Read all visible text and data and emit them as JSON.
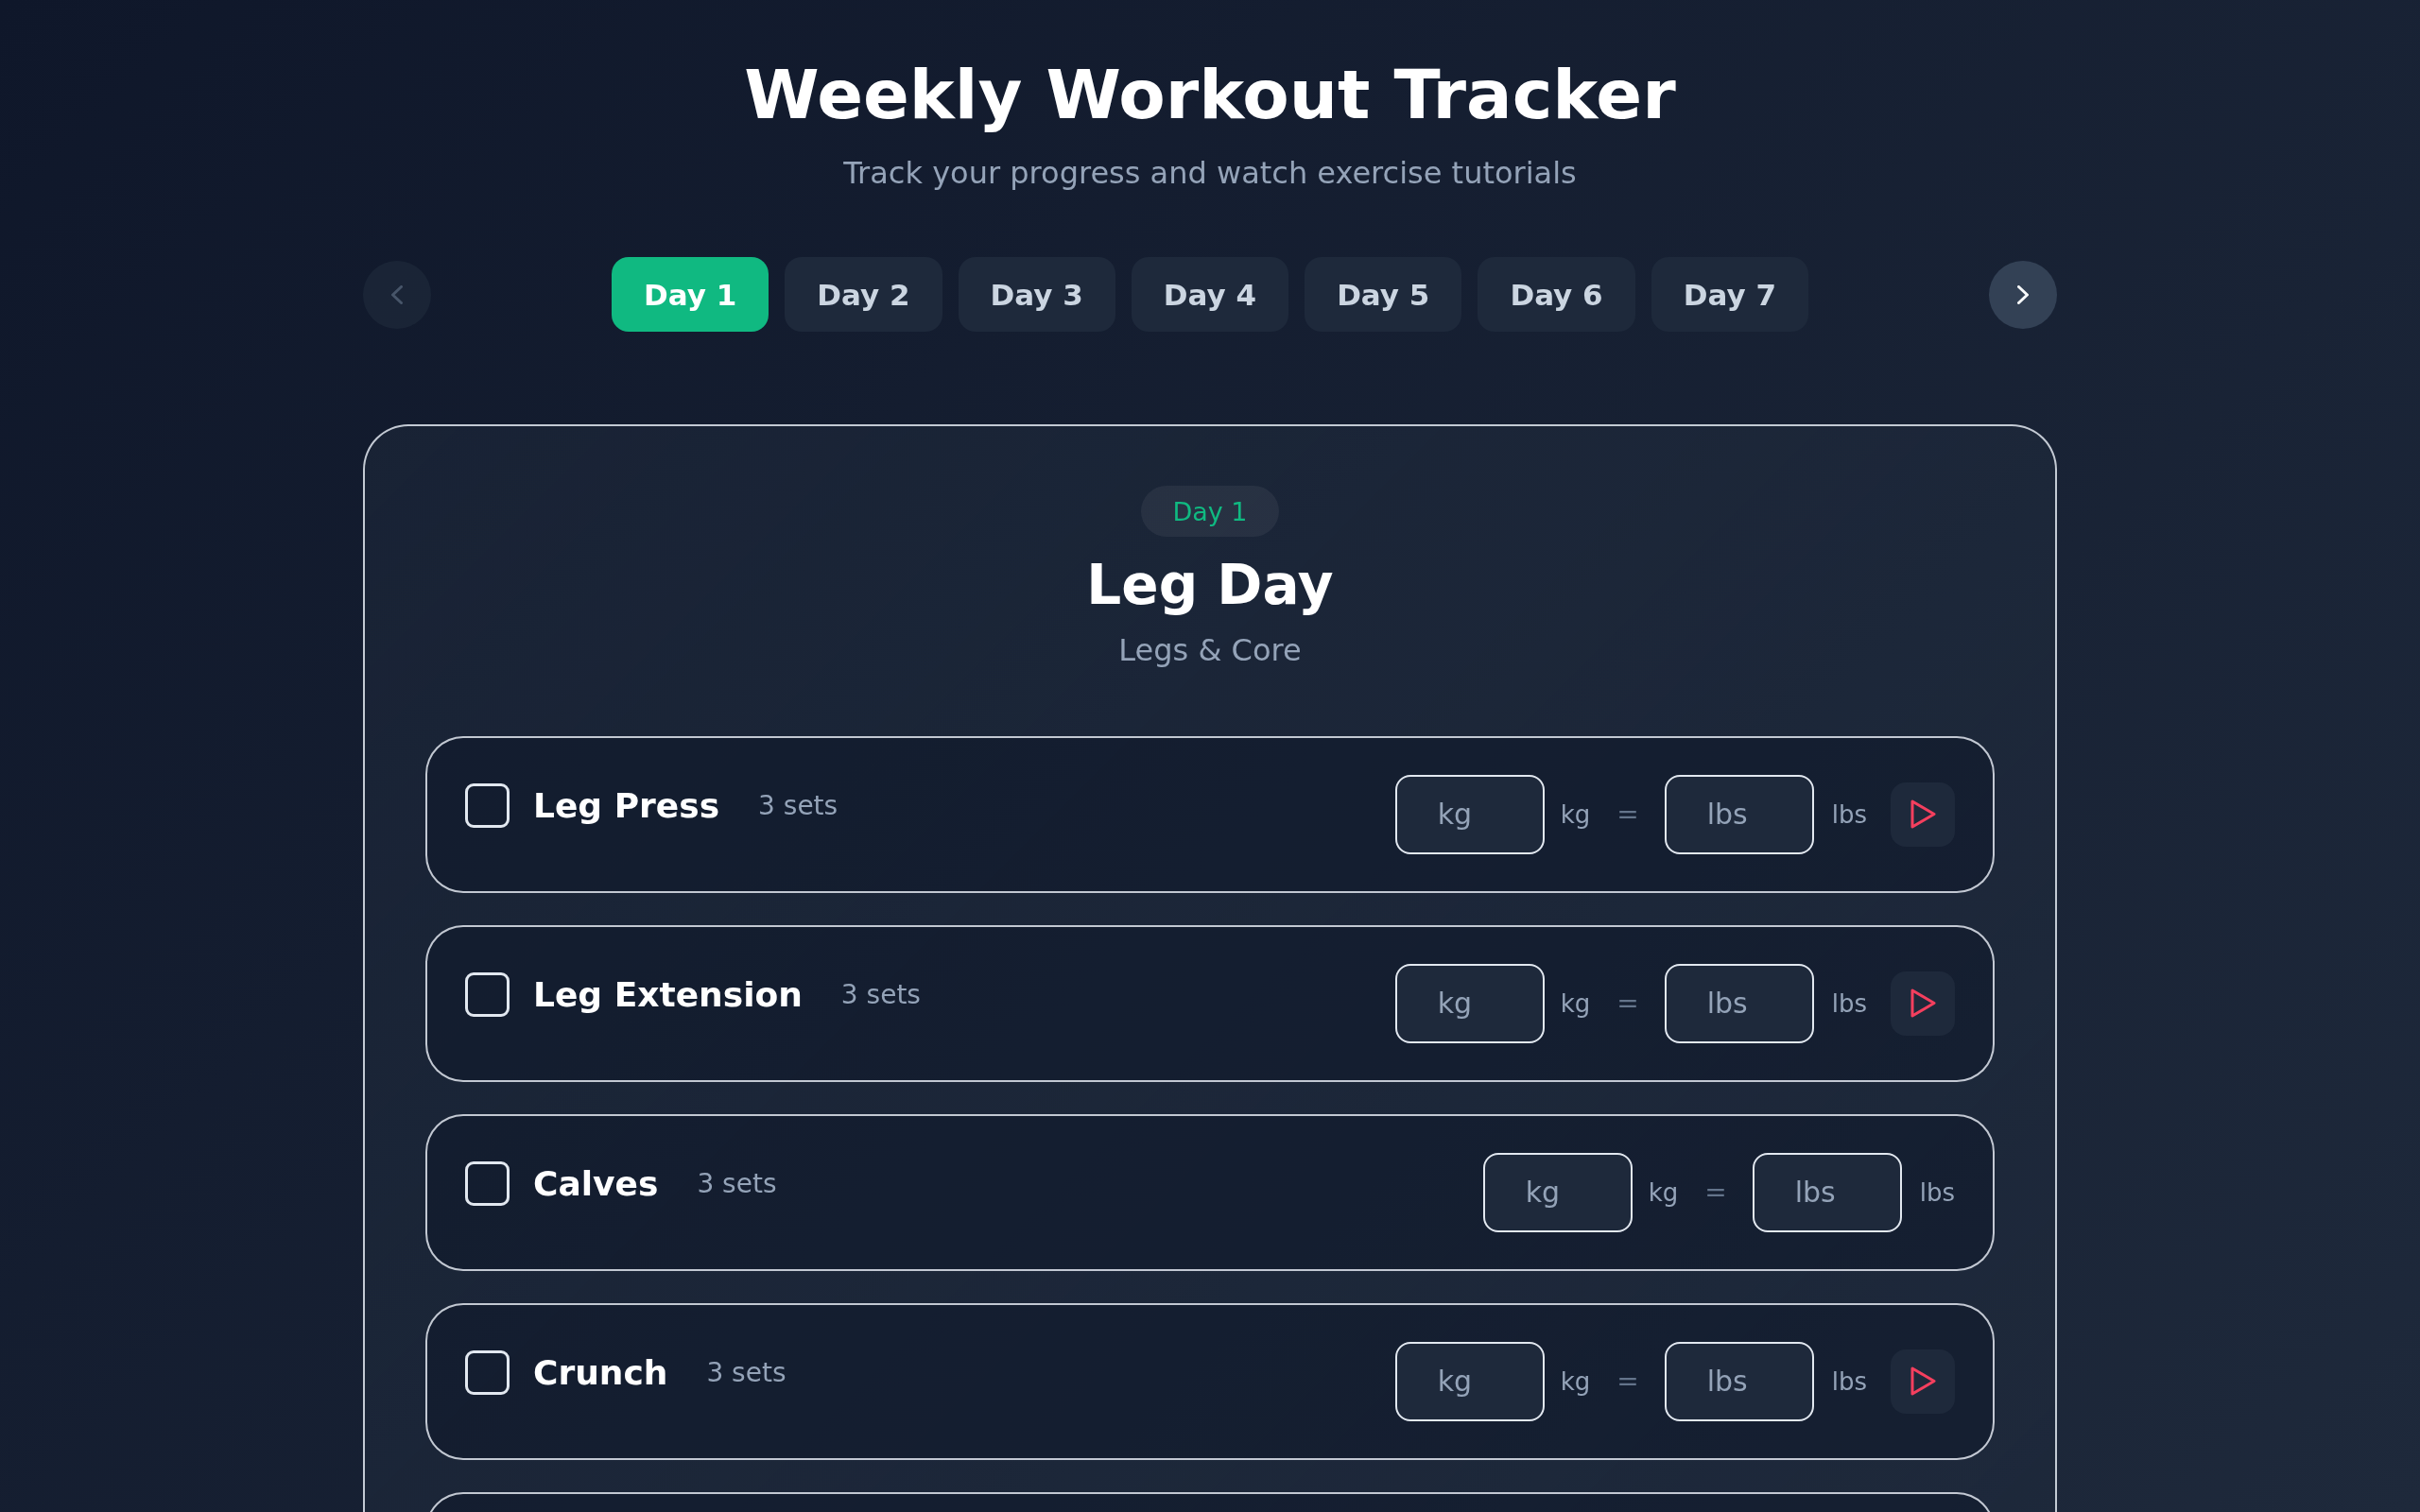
{
  "header": {
    "title": "Weekly Workout Tracker",
    "subtitle": "Track your progress and watch exercise tutorials"
  },
  "nav": {
    "prev": {
      "disabled": true
    },
    "next": {
      "disabled": false
    }
  },
  "tabs": [
    {
      "label": "Day 1",
      "selected": true
    },
    {
      "label": "Day 2",
      "selected": false
    },
    {
      "label": "Day 3",
      "selected": false
    },
    {
      "label": "Day 4",
      "selected": false
    },
    {
      "label": "Day 5",
      "selected": false
    },
    {
      "label": "Day 6",
      "selected": false
    },
    {
      "label": "Day 7",
      "selected": false
    }
  ],
  "day": {
    "badge": "Day 1",
    "title": "Leg Day",
    "focus": "Legs & Core"
  },
  "exercises": [
    {
      "name": "Leg Press",
      "sets": "3 sets",
      "checked": false,
      "kg_field": {
        "placeholder": "kg"
      },
      "kg_unit": "kg",
      "equals": "=",
      "lbs_field": {
        "placeholder": "lbs"
      },
      "lbs_unit": "lbs",
      "tutorial": true
    },
    {
      "name": "Leg Extension",
      "sets": "3 sets",
      "checked": false,
      "kg_field": {
        "placeholder": "kg"
      },
      "kg_unit": "kg",
      "equals": "=",
      "lbs_field": {
        "placeholder": "lbs"
      },
      "lbs_unit": "lbs",
      "tutorial": true
    },
    {
      "name": "Calves",
      "sets": "3 sets",
      "checked": false,
      "kg_field": {
        "placeholder": "kg"
      },
      "kg_unit": "kg",
      "equals": "=",
      "lbs_field": {
        "placeholder": "lbs"
      },
      "lbs_unit": "lbs",
      "tutorial": false
    },
    {
      "name": "Crunch",
      "sets": "3 sets",
      "checked": false,
      "kg_field": {
        "placeholder": "kg"
      },
      "kg_unit": "kg",
      "equals": "=",
      "lbs_field": {
        "placeholder": "lbs"
      },
      "lbs_unit": "lbs",
      "tutorial": true
    }
  ]
}
